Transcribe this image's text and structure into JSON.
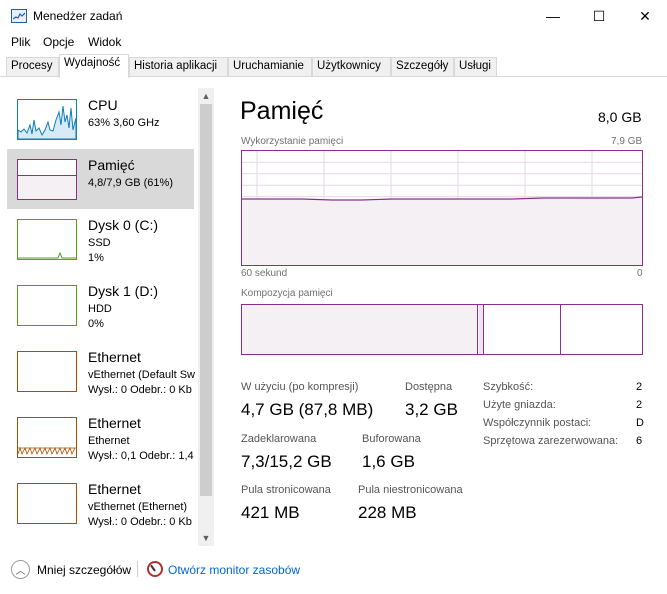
{
  "window": {
    "title": "Menedżer zadań",
    "minimize": "—",
    "maximize": "☐",
    "close": "✕"
  },
  "menu": [
    "Plik",
    "Opcje",
    "Widok"
  ],
  "tabs": [
    "Procesy",
    "Wydajność",
    "Historia aplikacji",
    "Uruchamianie",
    "Użytkownicy",
    "Szczegóły",
    "Usługi"
  ],
  "active_tab": "Wydajność",
  "sidebar": {
    "items": [
      {
        "name": "CPU",
        "lines": [
          "63%  3,60 GHz"
        ],
        "color": "#117dbb"
      },
      {
        "name": "Pamięć",
        "lines": [
          "4,8/7,9 GB (61%)"
        ],
        "color": "#8b2d8b"
      },
      {
        "name": "Dysk 0 (C:)",
        "lines": [
          "SSD",
          "1%"
        ],
        "color": "#4da60c"
      },
      {
        "name": "Dysk 1 (D:)",
        "lines": [
          "HDD",
          "0%"
        ],
        "color": "#4da60c"
      },
      {
        "name": "Ethernet",
        "lines": [
          "vEthernet (Default Sw",
          "Wysł.: 0 Odebr.: 0 Kb"
        ],
        "color": "#a74f01"
      },
      {
        "name": "Ethernet",
        "lines": [
          "Ethernet",
          "Wysł.: 0,1  Odebr.: 1,4"
        ],
        "color": "#a74f01"
      },
      {
        "name": "Ethernet",
        "lines": [
          "vEthernet (Ethernet)",
          "Wysł.: 0 Odebr.: 0 Kb"
        ],
        "color": "#a74f01"
      }
    ],
    "scroll_up": "▲",
    "scroll_down": "▼"
  },
  "main": {
    "title": "Pamięć",
    "total": "8,0 GB",
    "usage_label": "Wykorzystanie pamięci",
    "usage_max": "7,9 GB",
    "time_left": "60 sekund",
    "time_right": "0",
    "composition_label": "Kompozycja pamięci",
    "usage_fraction": 0.61,
    "stats": {
      "in_use_label": "W użyciu (po kompresji)",
      "in_use_value": "4,7 GB (87,8 MB)",
      "available_label": "Dostępna",
      "available_value": "3,2 GB",
      "committed_label": "Zadeklarowana",
      "committed_value": "7,3/15,2 GB",
      "cached_label": "Buforowana",
      "cached_value": "1,6 GB",
      "paged_label": "Pula stronicowana",
      "paged_value": "421 MB",
      "nonpaged_label": "Pula niestronicowana",
      "nonpaged_value": "228 MB"
    },
    "info": [
      {
        "label": "Szybkość:",
        "value": "2"
      },
      {
        "label": "Użyte gniazda:",
        "value": "2"
      },
      {
        "label": "Współczynnik postaci:",
        "value": "D"
      },
      {
        "label": "Sprzętowa zarezerwowana:",
        "value": "6"
      }
    ]
  },
  "footer": {
    "less_details": "Mniej szczegółów",
    "open_monitor": "Otwórz monitor zasobów"
  },
  "colors": {
    "memory": "#8b2d8b",
    "memory_fill": "#f4f0f4",
    "link": "#0066cc"
  }
}
